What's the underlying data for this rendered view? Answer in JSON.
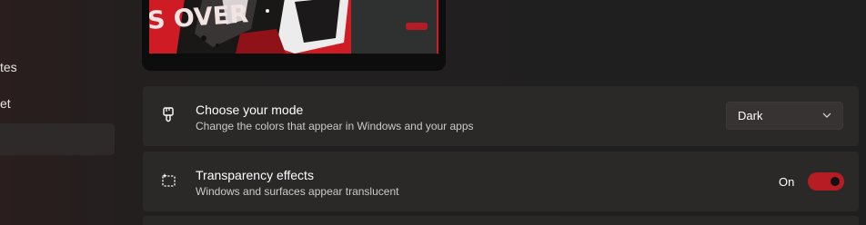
{
  "sidebar": {
    "items": [
      {
        "label": "tes"
      },
      {
        "label": "et"
      },
      {
        "label": ""
      }
    ]
  },
  "preview": {
    "art_text": "S OVER",
    "accent": "#d01c24"
  },
  "settings": {
    "mode": {
      "title": "Choose your mode",
      "description": "Change the colors that appear in Windows and your apps",
      "icon": "paint-brush-icon",
      "dropdown_value": "Dark"
    },
    "transparency": {
      "title": "Transparency effects",
      "description": "Windows and surfaces appear translucent",
      "icon": "transparency-icon",
      "toggle_label": "On",
      "toggle_on": true
    }
  },
  "colors": {
    "accent": "#b51c23",
    "background": "#201f1f",
    "card": "#2b2828"
  }
}
